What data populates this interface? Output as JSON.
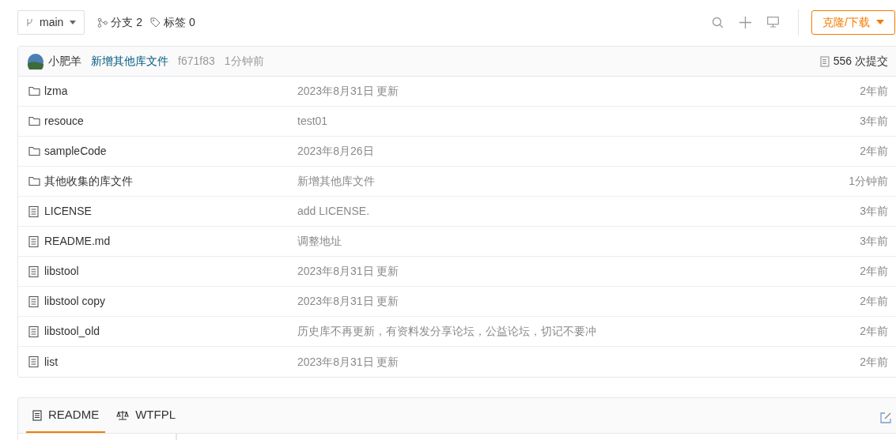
{
  "toolbar": {
    "branch": "main",
    "branches": "分支 2",
    "tags": "标签 0",
    "clone_button": "克隆/下载"
  },
  "commit": {
    "author": "小肥羊",
    "message": "新增其他库文件",
    "hash": "f671f83",
    "time": "1分钟前",
    "count": "556 次提交"
  },
  "files": [
    {
      "kind": "folder",
      "name": "lzma",
      "message": "2023年8月31日 更新",
      "time": "2年前"
    },
    {
      "kind": "folder",
      "name": "resouce",
      "message": "test01",
      "time": "3年前"
    },
    {
      "kind": "folder",
      "name": "sampleCode",
      "message": "2023年8月26日",
      "time": "2年前"
    },
    {
      "kind": "folder",
      "name": "其他收集的库文件",
      "message": "新增其他库文件",
      "time": "1分钟前"
    },
    {
      "kind": "file",
      "name": "LICENSE",
      "message": "add LICENSE.",
      "time": "3年前"
    },
    {
      "kind": "file",
      "name": "README.md",
      "message": "调整地址",
      "time": "3年前"
    },
    {
      "kind": "file",
      "name": "libstool",
      "message": "2023年8月31日 更新",
      "time": "2年前"
    },
    {
      "kind": "file",
      "name": "libstool copy",
      "message": "2023年8月31日 更新",
      "time": "2年前"
    },
    {
      "kind": "file",
      "name": "libstool_old",
      "message": "历史库不再更新，有资料发分享论坛，公益论坛，切记不要冲",
      "time": "2年前"
    },
    {
      "kind": "file",
      "name": "list",
      "message": "2023年8月31日 更新",
      "time": "2年前"
    }
  ],
  "readme_tabs": [
    {
      "kind": "readme",
      "label": "README",
      "selected": true
    },
    {
      "kind": "license",
      "label": "WTFPL",
      "selected": false
    }
  ]
}
